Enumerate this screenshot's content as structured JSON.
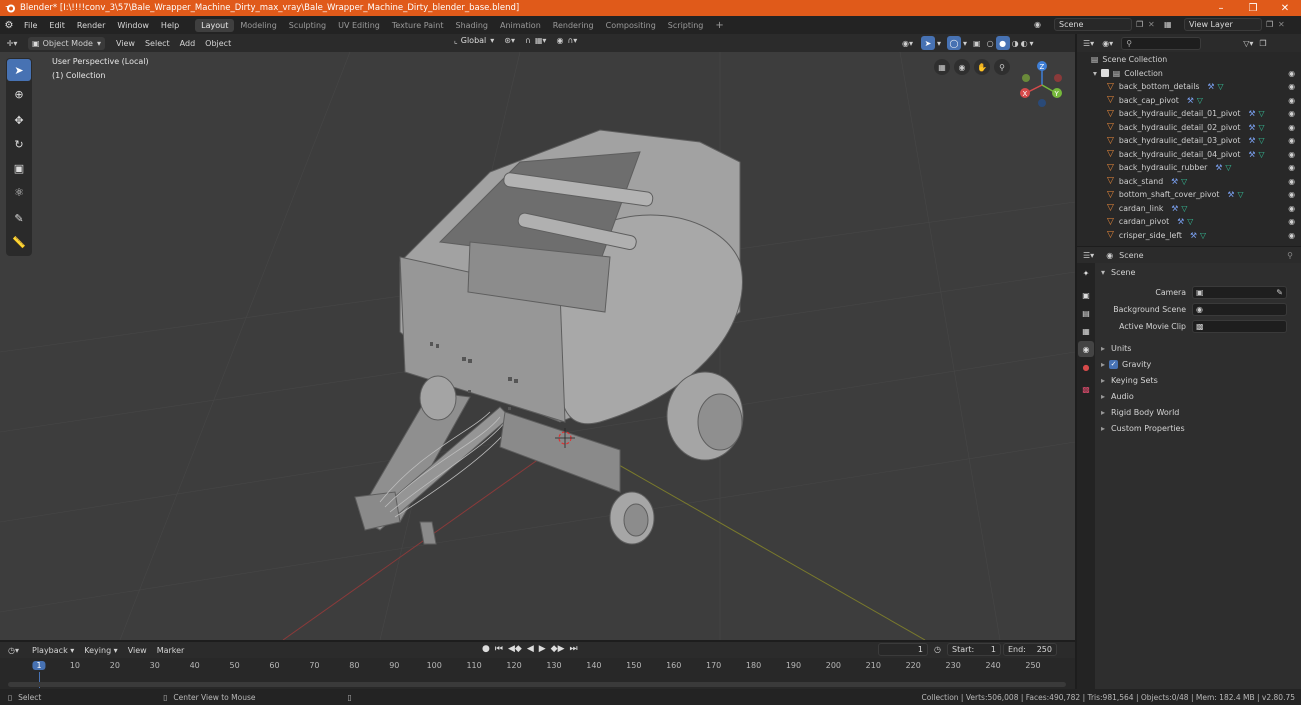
{
  "window": {
    "title": "Blender* [I:\\!!!!conv_3\\57\\Bale_Wrapper_Machine_Dirty_max_vray\\Bale_Wrapper_Machine_Dirty_blender_base.blend]"
  },
  "menus": [
    "File",
    "Edit",
    "Render",
    "Window",
    "Help"
  ],
  "workspaces": [
    "Layout",
    "Modeling",
    "Sculpting",
    "UV Editing",
    "Texture Paint",
    "Shading",
    "Animation",
    "Rendering",
    "Compositing",
    "Scripting"
  ],
  "active_workspace": "Layout",
  "scene_field": "Scene",
  "view_layer_field": "View Layer",
  "viewport_header": {
    "mode": "Object Mode",
    "menus": [
      "View",
      "Select",
      "Add",
      "Object"
    ],
    "transform_orientation": "Global"
  },
  "viewport": {
    "perspective_label": "User Perspective (Local)",
    "collection_label": "(1) Collection",
    "gizmo_axes": [
      "X",
      "Y",
      "Z"
    ]
  },
  "outliner": {
    "scene_collection": "Scene Collection",
    "collection": "Collection",
    "items": [
      "back_bottom_details",
      "back_cap_pivot",
      "back_hydraulic_detail_01_pivot",
      "back_hydraulic_detail_02_pivot",
      "back_hydraulic_detail_03_pivot",
      "back_hydraulic_detail_04_pivot",
      "back_hydraulic_rubber",
      "back_stand",
      "bottom_shaft_cover_pivot",
      "cardan_link",
      "cardan_pivot",
      "crisper_side_left"
    ]
  },
  "properties": {
    "context": "Scene",
    "panel_title": "Scene",
    "fields": [
      {
        "label": "Camera",
        "value": ""
      },
      {
        "label": "Background Scene",
        "value": ""
      },
      {
        "label": "Active Movie Clip",
        "value": ""
      }
    ],
    "subpanels": [
      "Units",
      "Gravity",
      "Keying Sets",
      "Audio",
      "Rigid Body World",
      "Custom Properties"
    ],
    "gravity_checked": true
  },
  "timeline": {
    "menus": [
      "Playback",
      "Keying",
      "View",
      "Marker"
    ],
    "current_frame": "1",
    "start_label": "Start:",
    "start": "1",
    "end_label": "End:",
    "end": "250",
    "ticks": [
      "1",
      "10",
      "20",
      "30",
      "40",
      "50",
      "60",
      "70",
      "80",
      "90",
      "100",
      "110",
      "120",
      "130",
      "140",
      "150",
      "160",
      "170",
      "180",
      "190",
      "200",
      "210",
      "220",
      "230",
      "240",
      "250"
    ]
  },
  "statusbar": {
    "select": "Select",
    "center_view": "Center View to Mouse",
    "stats": "Collection | Verts:506,008 | Faces:490,782 | Tris:981,564 | Objects:0/48 | Mem: 182.4 MB | v2.80.75"
  },
  "colors": {
    "title_bar": "#e05a1a",
    "accent": "#4772b3",
    "object_icon": "#e8883a",
    "mesh_icon": "#35c19a",
    "modifier_icon": "#7aa0f0"
  }
}
